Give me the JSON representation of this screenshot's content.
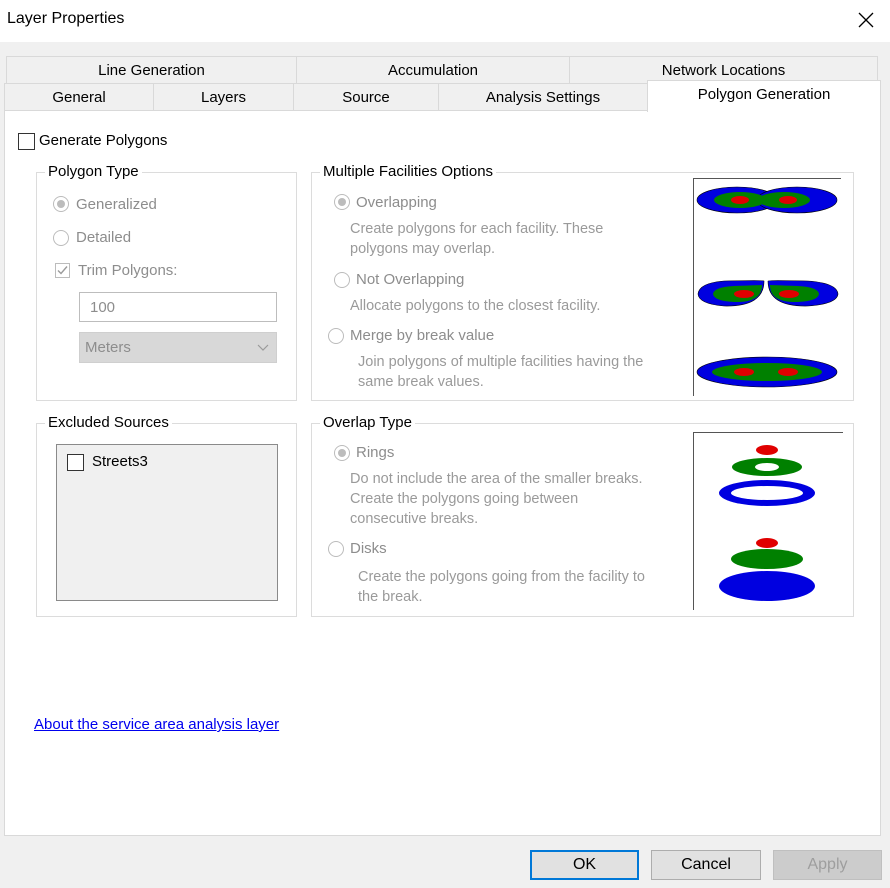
{
  "window": {
    "title": "Layer Properties"
  },
  "tabs": {
    "row1": [
      {
        "label": "Line Generation"
      },
      {
        "label": "Accumulation"
      },
      {
        "label": "Network Locations"
      }
    ],
    "row2": [
      {
        "label": "General"
      },
      {
        "label": "Layers"
      },
      {
        "label": "Source"
      },
      {
        "label": "Analysis Settings"
      },
      {
        "label": "Polygon Generation",
        "active": true
      }
    ]
  },
  "generate_polygons": {
    "label": "Generate Polygons",
    "checked": false
  },
  "polygon_type": {
    "title": "Polygon Type",
    "generalized": "Generalized",
    "detailed": "Detailed",
    "trim_label": "Trim Polygons:",
    "trim_value": "100",
    "units": "Meters"
  },
  "multiple_facilities": {
    "title": "Multiple Facilities Options",
    "overlapping": "Overlapping",
    "overlapping_desc": [
      "Create polygons for each facility. These",
      "polygons may overlap."
    ],
    "not_overlapping": "Not Overlapping",
    "not_overlapping_desc": [
      "Allocate polygons to the closest facility."
    ],
    "merge": "Merge by break value",
    "merge_desc": [
      "Join polygons of multiple facilities having the",
      "same break values."
    ]
  },
  "excluded_sources": {
    "title": "Excluded Sources",
    "items": [
      {
        "label": "Streets3",
        "checked": false
      }
    ]
  },
  "overlap_type": {
    "title": "Overlap Type",
    "rings": "Rings",
    "rings_desc": [
      "Do not include the area of the smaller breaks.",
      "Create the polygons going between",
      "consecutive breaks."
    ],
    "disks": "Disks",
    "disks_desc": [
      "Create the polygons going from the facility to",
      "the break."
    ]
  },
  "help_link": "About the service area analysis layer",
  "buttons": {
    "ok": "OK",
    "cancel": "Cancel",
    "apply": "Apply"
  },
  "colors": {
    "blue": "#0000e0",
    "green": "#008000",
    "red": "#e00000",
    "accent": "#0078d7"
  }
}
